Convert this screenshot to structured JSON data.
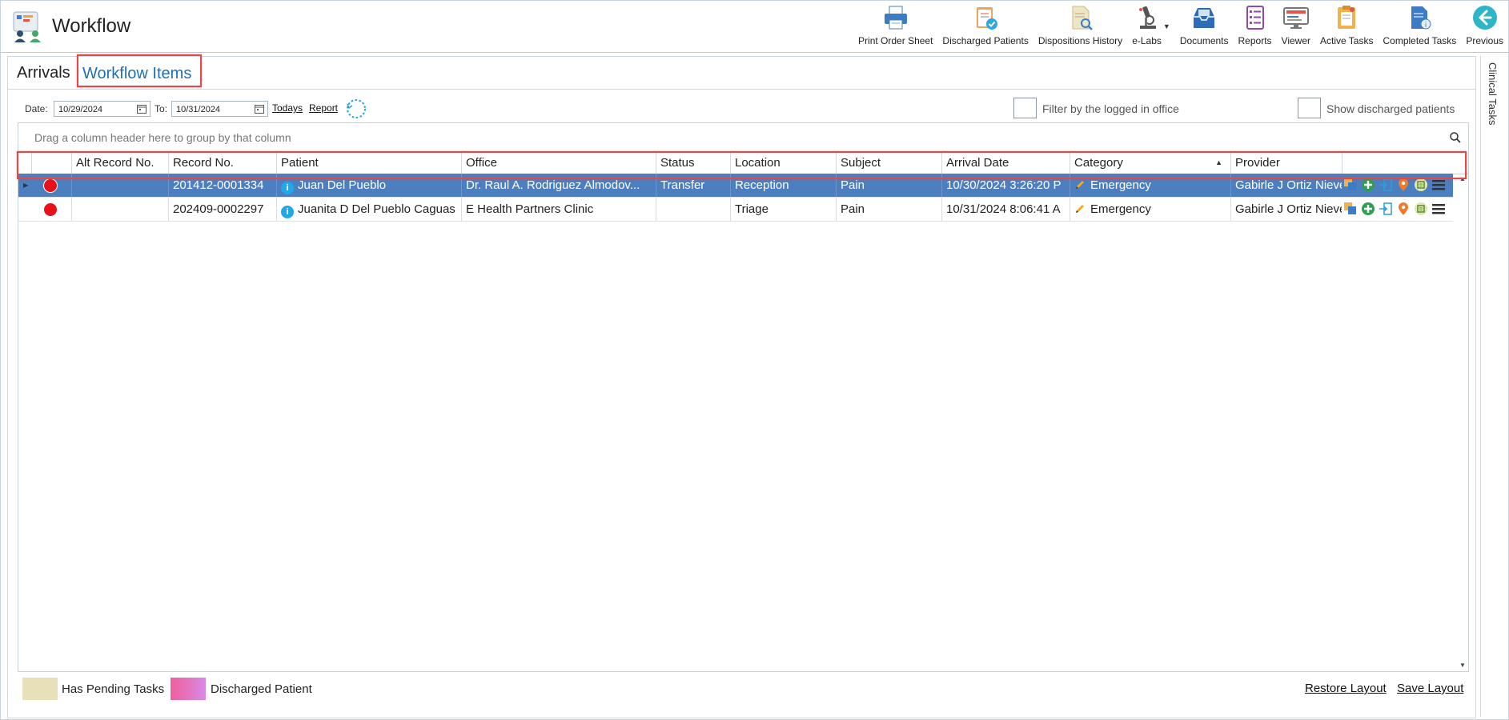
{
  "app": {
    "title": "Workflow"
  },
  "toolbar": [
    {
      "label": "Print Order Sheet",
      "icon": "printer-icon"
    },
    {
      "label": "Discharged Patients",
      "icon": "clipboard-check-icon"
    },
    {
      "label": "Dispositions History",
      "icon": "document-search-icon"
    },
    {
      "label": "e-Labs",
      "icon": "microscope-icon"
    },
    {
      "label": "Documents",
      "icon": "inbox-tray-icon"
    },
    {
      "label": "Reports",
      "icon": "report-list-icon"
    },
    {
      "label": "Viewer",
      "icon": "monitor-icon"
    },
    {
      "label": "Active Tasks",
      "icon": "task-folder-icon"
    },
    {
      "label": "Completed Tasks",
      "icon": "completed-doc-icon"
    },
    {
      "label": "Previous",
      "icon": "back-arrow-icon"
    }
  ],
  "tabs": {
    "arrivals": "Arrivals",
    "workflow_items": "Workflow Items",
    "active": "Workflow Items"
  },
  "right_panel": {
    "label": "Clinical Tasks"
  },
  "filters": {
    "date_label": "Date:",
    "date_from": "10/29/2024",
    "to_label": "To:",
    "date_to": "10/31/2024",
    "todays_link": "Todays",
    "report_link": "Report",
    "filter_office_label": "Filter by the logged in office",
    "filter_office_checked": false,
    "show_discharged_label": "Show discharged patients",
    "show_discharged_checked": false
  },
  "grid": {
    "group_hint": "Drag a column header here to group by that column",
    "columns": [
      {
        "key": "alt_record",
        "label": "Alt Record No."
      },
      {
        "key": "record",
        "label": "Record No."
      },
      {
        "key": "patient",
        "label": "Patient"
      },
      {
        "key": "office",
        "label": "Office"
      },
      {
        "key": "status",
        "label": "Status"
      },
      {
        "key": "location",
        "label": "Location"
      },
      {
        "key": "subject",
        "label": "Subject"
      },
      {
        "key": "arrival_date",
        "label": "Arrival Date"
      },
      {
        "key": "category",
        "label": "Category",
        "sort": "ascending"
      },
      {
        "key": "provider",
        "label": "Provider"
      }
    ],
    "rows": [
      {
        "selected": true,
        "alt_record": "",
        "record": "201412-0001334",
        "patient": "Juan Del Pueblo",
        "office": "Dr. Raul A. Rodriguez Almodov...",
        "status": "Transfer",
        "location": "Reception",
        "subject": "Pain",
        "arrival_date": "10/30/2024 3:26:20 P",
        "category": "Emergency",
        "provider": "Gabirle J Ortiz Nieve"
      },
      {
        "selected": false,
        "alt_record": "",
        "record": "202409-0002297",
        "patient": "Juanita D Del Pueblo Caguas",
        "office": "E Health Partners Clinic",
        "status": "",
        "location": "Triage",
        "subject": "Pain",
        "arrival_date": "10/31/2024 8:06:41 A",
        "category": "Emergency",
        "provider": "Gabirle J Ortiz Nieve"
      }
    ]
  },
  "legend": [
    {
      "label": "Has Pending Tasks",
      "color": "#e8e0b8"
    },
    {
      "label": "Discharged Patient",
      "color": "#e066a6"
    }
  ],
  "footer": {
    "restore_layout": "Restore Layout",
    "save_layout": "Save Layout"
  },
  "colors": {
    "selected_row": "#4c7fbf",
    "tab_active": "#1f6fb8",
    "highlight_box": "#e04a48",
    "status_dot": "#e8101a"
  }
}
